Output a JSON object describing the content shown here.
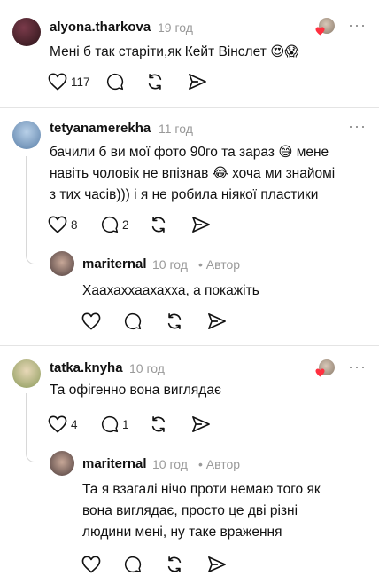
{
  "comments": [
    {
      "username": "alyona.tharkova",
      "time": "19 год",
      "text": "Мені б так старіти,як Кейт Вінслет 😍😱",
      "likes": "117",
      "replies": ""
    },
    {
      "username": "tetyanamerekha",
      "time": "11 год",
      "text": "бачили б ви мої фото 90го та зараз 😅 мене\nнавіть чоловік не впізнав 😂 хоча ми знайомі\nз тих часів))) і я не робила ніякої пластики",
      "likes": "8",
      "replies": "2"
    },
    {
      "username": "mariternal",
      "time": "10 год",
      "author_badge": "• Автор",
      "text": "Хаахаххаахахха, а покажіть",
      "likes": "",
      "replies": ""
    },
    {
      "username": "tatka.knyha",
      "time": "10 год",
      "text": "Та офігенно вона виглядає",
      "likes": "4",
      "replies": "1"
    },
    {
      "username": "mariternal",
      "time": "10 год",
      "author_badge": "• Автор",
      "text": "Та я взагалі нічо проти немаю того як\nвона виглядає, просто це дві різні\nлюдини мені, ну таке враження",
      "likes": "",
      "replies": ""
    }
  ],
  "more_label": "···",
  "colors": {
    "text": "#111111",
    "meta": "#9a9a9a",
    "heart_red": "#ff3040",
    "divider": "#e4e4e4"
  }
}
